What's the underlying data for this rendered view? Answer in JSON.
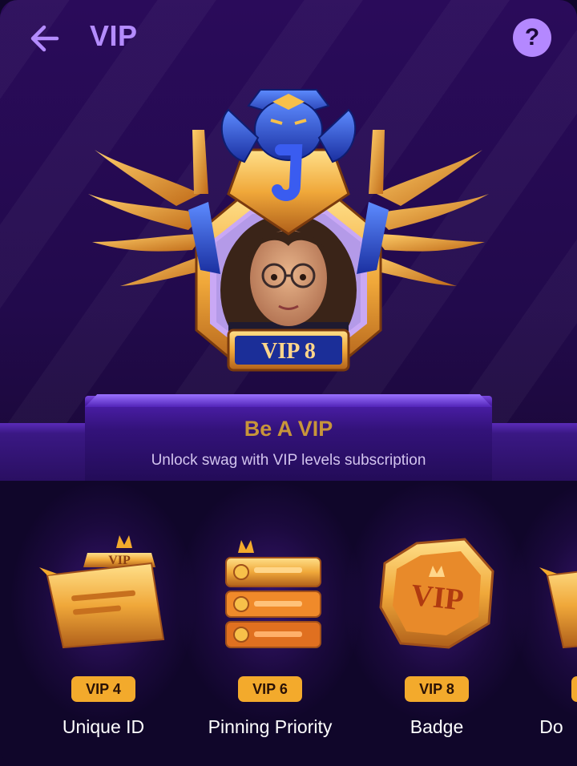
{
  "header": {
    "title": "VIP",
    "back_icon": "arrow-left-icon",
    "help_icon": "question-icon",
    "help_glyph": "?",
    "accent_color": "#b48cff"
  },
  "hero": {
    "badge_text": "VIP 8",
    "title": "Be A VIP",
    "subtitle": "Unlock swag with VIP levels subscription"
  },
  "perks": [
    {
      "level": "VIP 4",
      "label": "Unique ID",
      "icon": "vip-card-icon"
    },
    {
      "level": "VIP 6",
      "label": "Pinning Priority",
      "icon": "pinned-list-icon"
    },
    {
      "level": "VIP 8",
      "label": "Badge",
      "icon": "vip-badge-icon"
    },
    {
      "level": "",
      "label": "Do",
      "icon": "vip-card-icon"
    }
  ],
  "colors": {
    "gold": "#f3aa2c",
    "title_gold": "#c8953a",
    "background": "#10062a"
  }
}
